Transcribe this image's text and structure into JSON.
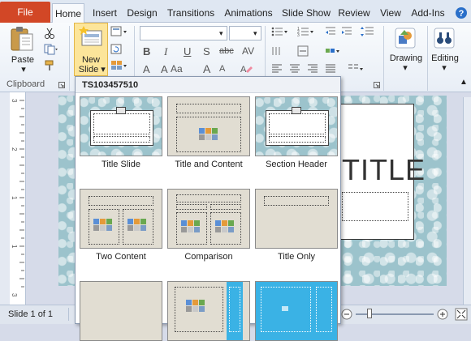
{
  "tabs": {
    "file": "File",
    "home": "Home",
    "insert": "Insert",
    "design": "Design",
    "transitions": "Transitions",
    "animations": "Animations",
    "slideshow": "Slide Show",
    "review": "Review",
    "view": "View",
    "addins": "Add-Ins"
  },
  "ribbon": {
    "paste": "Paste",
    "new_slide_line1": "New",
    "new_slide_line2": "Slide",
    "clipboard": "Clipboard",
    "drawing": "Drawing",
    "editing": "Editing"
  },
  "dropdown": {
    "theme_name": "TS103457510",
    "layouts": [
      {
        "label": "Title Slide"
      },
      {
        "label": "Title and Content"
      },
      {
        "label": "Section Header"
      },
      {
        "label": "Two Content"
      },
      {
        "label": "Comparison"
      },
      {
        "label": "Title Only"
      }
    ]
  },
  "slide": {
    "title_text": "TITLE"
  },
  "status": {
    "slide_counter": "Slide 1 of 1"
  },
  "colors": {
    "file_tab": "#d24726",
    "accent_selected": "#f3c35c",
    "slide_bg": "#86b4be"
  }
}
